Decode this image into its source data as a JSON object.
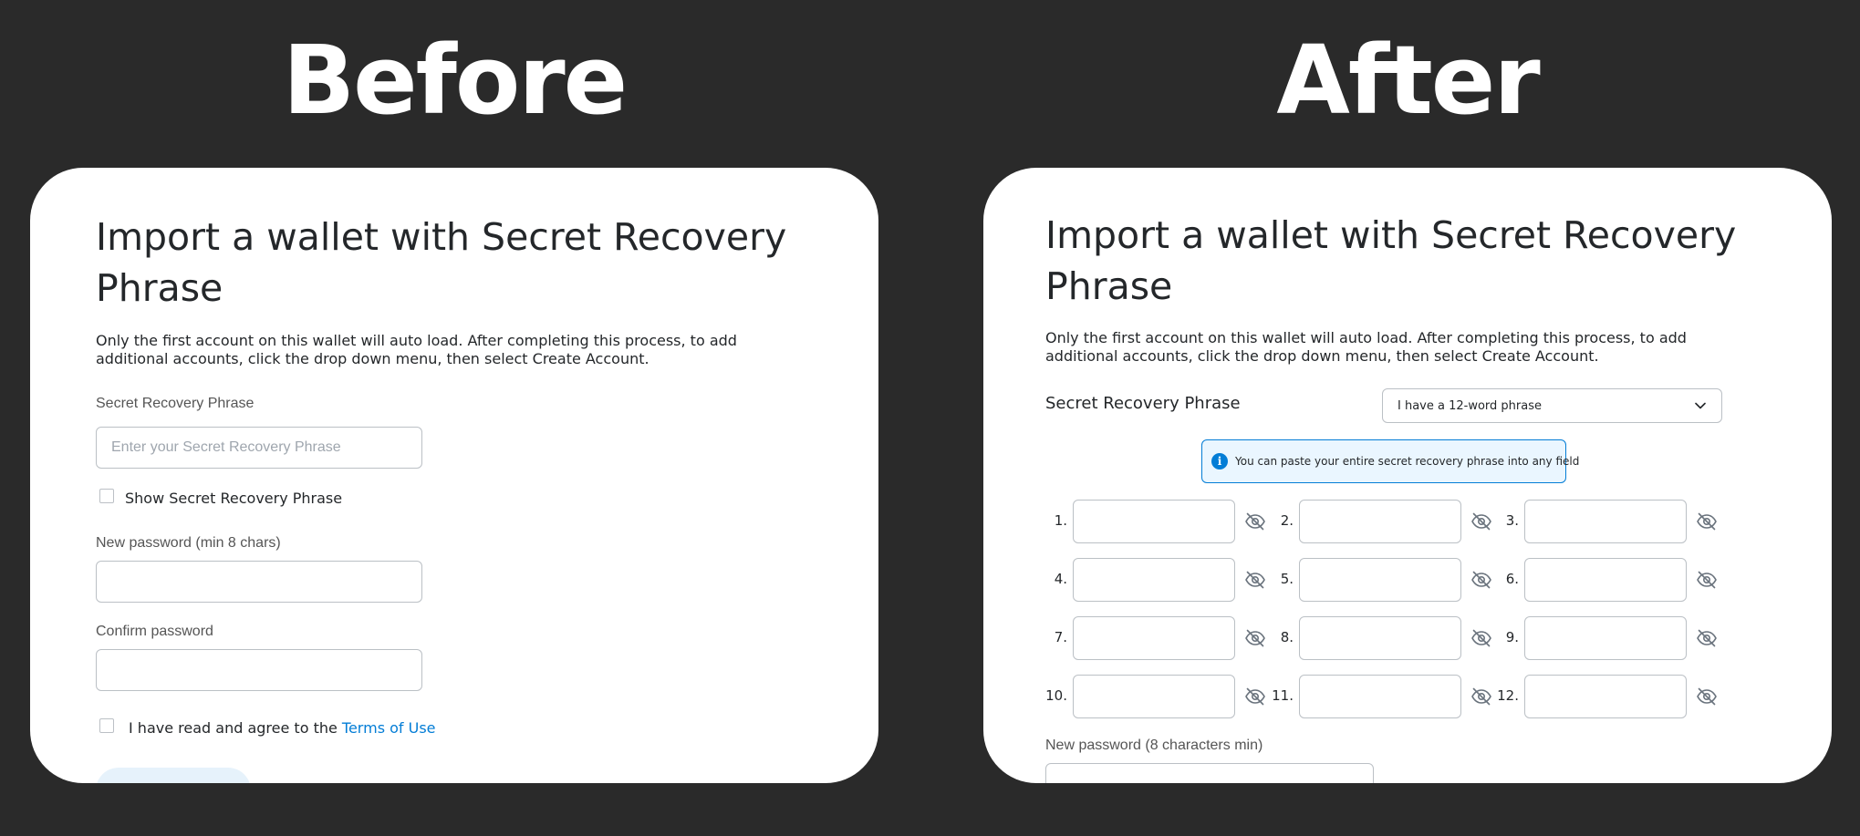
{
  "before": {
    "heading": "Before",
    "title": "Import a wallet with Secret Recovery Phrase",
    "description": "Only the first account on this wallet will auto load. After completing this process, to add additional accounts, click the drop down menu, then select Create Account.",
    "srp_label": "Secret Recovery Phrase",
    "srp_placeholder": "Enter your Secret Recovery Phrase",
    "show_srp_label": "Show Secret Recovery Phrase",
    "new_password_label": "New password (min 8 chars)",
    "confirm_password_label": "Confirm password",
    "terms_prefix": "I have read and agree to the ",
    "terms_link": "Terms of Use"
  },
  "after": {
    "heading": "After",
    "title": "Import a wallet with Secret Recovery Phrase",
    "description": "Only the first account on this wallet will auto load. After completing this process, to add additional accounts, click the drop down menu, then select Create Account.",
    "srp_label": "Secret Recovery Phrase",
    "phrase_length_selected": "I have a 12-word phrase",
    "info_banner": "You can paste your entire secret recovery phrase into any field",
    "word_numbers": [
      "1.",
      "2.",
      "3.",
      "4.",
      "5.",
      "6.",
      "7.",
      "8.",
      "9.",
      "10.",
      "11.",
      "12."
    ],
    "new_password_label": "New password (8 characters min)"
  },
  "colors": {
    "background": "#2a2a2a",
    "card": "#ffffff",
    "link": "#037dd6",
    "info_bg": "#eaf6ff",
    "border": "#bbc0c5"
  },
  "icons": {
    "eye": "eye-slash-icon",
    "info": "info-icon",
    "chevron": "chevron-down-icon"
  }
}
